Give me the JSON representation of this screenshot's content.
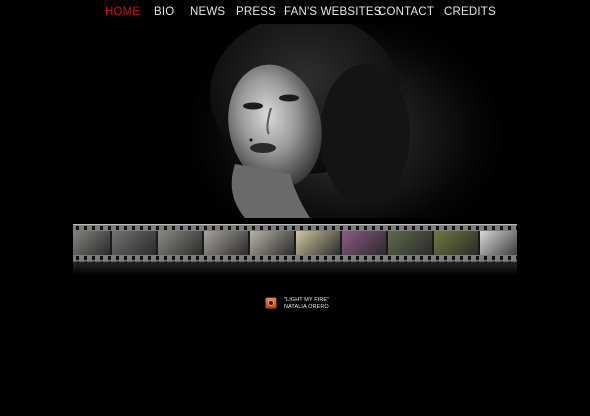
{
  "nav": {
    "items": [
      {
        "label": "HOME",
        "active": true
      },
      {
        "label": "BIO",
        "active": false
      },
      {
        "label": "NEWS",
        "active": false
      },
      {
        "label": "PRESS",
        "active": false
      },
      {
        "label": "FAN'S WEBSITES",
        "active": false
      },
      {
        "label": "CONTACT",
        "active": false
      },
      {
        "label": "CREDITS",
        "active": false
      }
    ],
    "active_color": "#c4161c",
    "text_color": "#e6e6e6"
  },
  "hero": {
    "image": "portrait-photo"
  },
  "filmstrip": {
    "frames": [
      {
        "color": "#8a8f86"
      },
      {
        "color": "#6f7370"
      },
      {
        "color": "#8c8a84"
      },
      {
        "color": "#a8a29c"
      },
      {
        "color": "#b9b3a8"
      },
      {
        "color": "#d1c7a0"
      },
      {
        "color": "#8d5a86"
      },
      {
        "color": "#5f6a4c"
      },
      {
        "color": "#6e7a3c"
      },
      {
        "color": "#d8d8d8"
      },
      {
        "color": "#84867c"
      }
    ]
  },
  "player": {
    "icon": "music-player-icon",
    "accent": "#e0762c",
    "song_title": "\"LIGHT MY FIRE\"",
    "artist": "NATALIA ORERO"
  }
}
